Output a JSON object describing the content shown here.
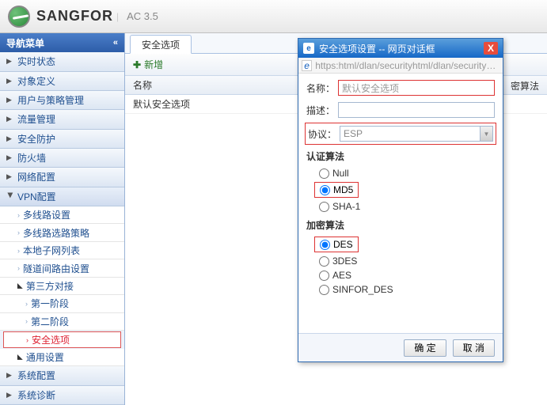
{
  "header": {
    "brand": "SANGFOR",
    "version": "AC 3.5"
  },
  "sidebar": {
    "title": "导航菜单",
    "items": [
      {
        "label": "实时状态"
      },
      {
        "label": "对象定义"
      },
      {
        "label": "用户与策略管理"
      },
      {
        "label": "流量管理"
      },
      {
        "label": "安全防护"
      },
      {
        "label": "防火墙"
      },
      {
        "label": "网络配置"
      }
    ],
    "vpn": {
      "label": "VPN配置",
      "children": [
        {
          "label": "多线路设置"
        },
        {
          "label": "多线路选路策略"
        },
        {
          "label": "本地子网列表"
        },
        {
          "label": "隧道间路由设置"
        }
      ],
      "third": {
        "label": "第三方对接",
        "children": [
          {
            "label": "第一阶段"
          },
          {
            "label": "第二阶段"
          },
          {
            "label": "安全选项"
          }
        ]
      },
      "general": {
        "label": "通用设置"
      }
    },
    "tail": [
      {
        "label": "系统配置"
      },
      {
        "label": "系统诊断"
      }
    ]
  },
  "main": {
    "tab": "安全选项",
    "add": "新增",
    "col": "名称",
    "row0": "默认安全选项",
    "behind_label": "密算法"
  },
  "dialog": {
    "title": "安全选项设置 -- 网页对话框",
    "url": "https:html/dlan/securityhtml/dlan/security_op…",
    "name_label": "名称：",
    "name_value": "默认安全选项",
    "desc_label": "描述：",
    "desc_value": "",
    "proto_label": "协议：",
    "proto_value": "ESP",
    "auth_group": "认证算法",
    "auth_opts": [
      "Null",
      "MD5",
      "SHA-1"
    ],
    "auth_selected": "MD5",
    "enc_group": "加密算法",
    "enc_opts": [
      "DES",
      "3DES",
      "AES",
      "SINFOR_DES"
    ],
    "enc_selected": "DES",
    "ok": "确 定",
    "cancel": "取 消"
  }
}
